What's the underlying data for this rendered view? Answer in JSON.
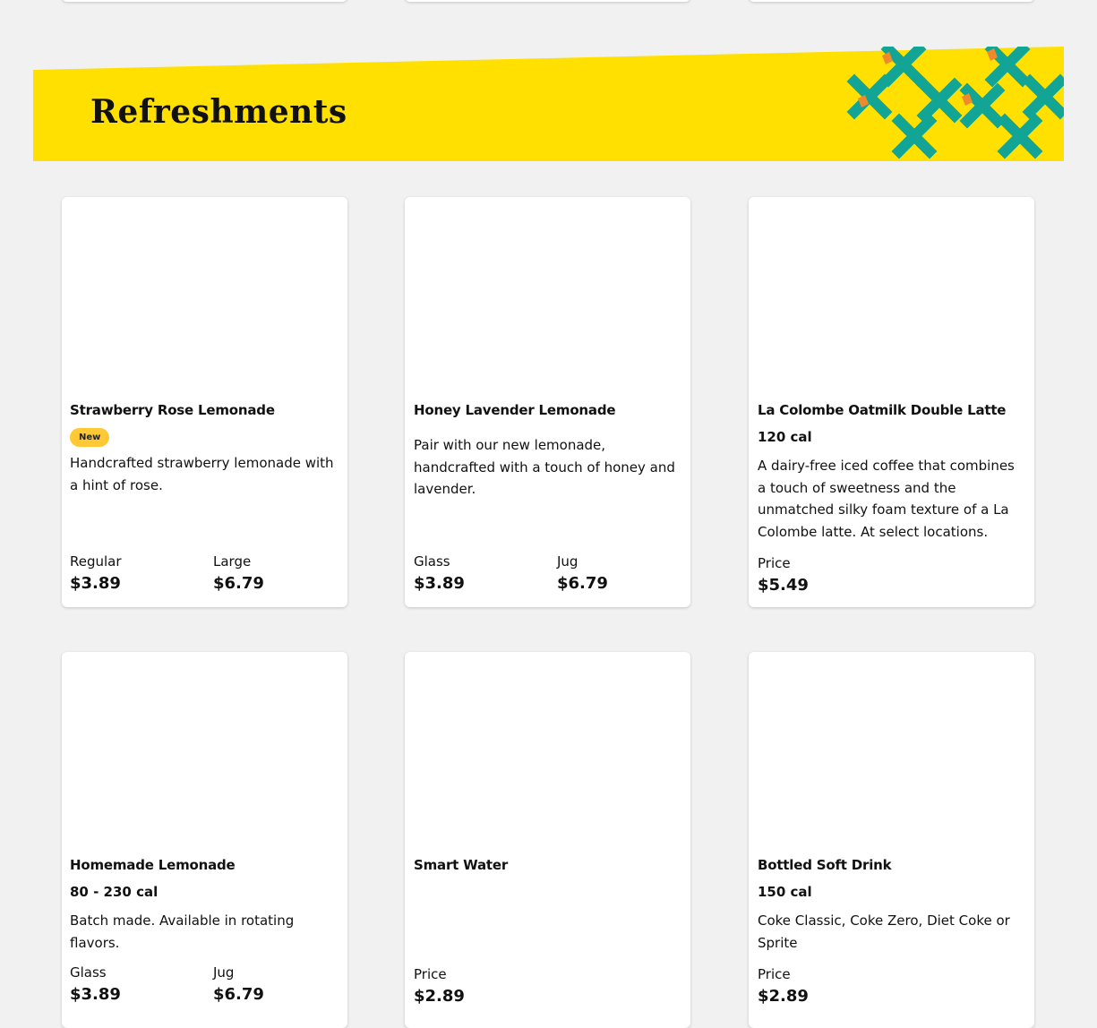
{
  "section": {
    "title": "Refreshments"
  },
  "colors": {
    "banner": "#ffe000",
    "pattern_teal": "#12a596",
    "pattern_orange": "#ef8a2c",
    "badge": "#ffc936"
  },
  "items": [
    {
      "name": "Strawberry Rose Lemonade",
      "badge": "New",
      "description": "Handcrafted strawberry lemonade with a hint of rose.",
      "prices": [
        {
          "label": "Regular",
          "value": "$3.89"
        },
        {
          "label": "Large",
          "value": "$6.79"
        }
      ]
    },
    {
      "name": "Honey Lavender Lemonade",
      "description": "Pair with our new lemonade, handcrafted with a touch of honey and lavender.",
      "prices": [
        {
          "label": "Glass",
          "value": "$3.89"
        },
        {
          "label": "Jug",
          "value": "$6.79"
        }
      ]
    },
    {
      "name": "La Colombe Oatmilk Double Latte",
      "calories": "120 cal",
      "description": "A dairy-free iced coffee that combines a touch of sweetness and the unmatched silky foam texture of a La Colombe latte. At select locations.",
      "prices": [
        {
          "label": "Price",
          "value": "$5.49"
        }
      ]
    },
    {
      "name": "Homemade Lemonade",
      "calories": "80 - 230 cal",
      "description": "Batch made. Available in rotating flavors.",
      "prices": [
        {
          "label": "Glass",
          "value": "$3.89"
        },
        {
          "label": "Jug",
          "value": "$6.79"
        }
      ]
    },
    {
      "name": "Smart Water",
      "prices": [
        {
          "label": "Price",
          "value": "$2.89"
        }
      ]
    },
    {
      "name": "Bottled Soft Drink",
      "calories": "150 cal",
      "description": "Coke Classic, Coke Zero, Diet Coke or Sprite",
      "prices": [
        {
          "label": "Price",
          "value": "$2.89"
        }
      ]
    }
  ]
}
